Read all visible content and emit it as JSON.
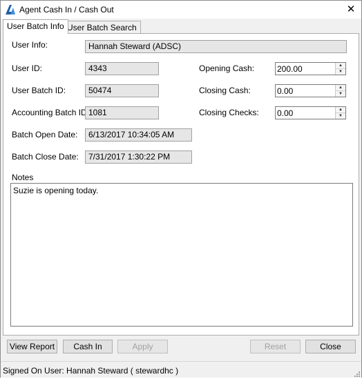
{
  "window": {
    "title": "Agent Cash In / Cash Out",
    "close_glyph": "✕"
  },
  "tabs": [
    {
      "label": "User Batch Info",
      "active": true
    },
    {
      "label": "User Batch Search",
      "active": false
    }
  ],
  "fields": {
    "user_info": {
      "label": "User Info:",
      "value": "Hannah Steward (ADSC)"
    },
    "user_id": {
      "label": "User ID:",
      "value": "4343"
    },
    "user_batch_id": {
      "label": "User Batch ID:",
      "value": "50474"
    },
    "accounting_batch_id": {
      "label": "Accounting Batch ID:",
      "value": "1081"
    },
    "batch_open_date": {
      "label": "Batch Open Date:",
      "value": "6/13/2017 10:34:05 AM"
    },
    "batch_close_date": {
      "label": "Batch Close Date:",
      "value": "7/31/2017 1:30:22 PM"
    },
    "opening_cash": {
      "label": "Opening Cash:",
      "value": "200.00"
    },
    "closing_cash": {
      "label": "Closing Cash:",
      "value": "0.00"
    },
    "closing_checks": {
      "label": "Closing Checks:",
      "value": "0.00"
    }
  },
  "notes": {
    "label": "Notes",
    "value": "Suzie is opening today."
  },
  "buttons": {
    "view_report": "View Report",
    "cash_in": "Cash In",
    "apply": "Apply",
    "reset": "Reset",
    "close": "Close"
  },
  "status": {
    "text": "Signed On User: Hannah Steward ( stewardhc )"
  },
  "colors": {
    "accent": "#0078d7",
    "readonly_bg": "#e6e6e6",
    "disabled_text": "#a0a0a0"
  }
}
